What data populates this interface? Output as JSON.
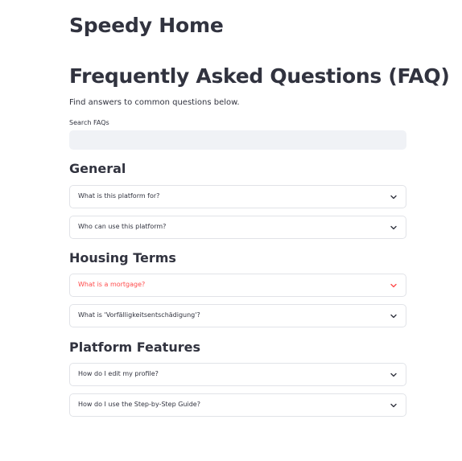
{
  "app": {
    "title": "Speedy Home"
  },
  "page": {
    "title": "Frequently Asked Questions (FAQ)",
    "subtitle": "Find answers to common questions below."
  },
  "search": {
    "label": "Search FAQs",
    "value": "",
    "placeholder": ""
  },
  "sections": [
    {
      "heading": "General",
      "items": [
        {
          "question": "What is this platform for?"
        },
        {
          "question": "Who can use this platform?"
        }
      ]
    },
    {
      "heading": "Housing Terms",
      "items": [
        {
          "question": "What is a mortgage?",
          "highlighted": true
        },
        {
          "question": "What is 'Vorfälligkeitsentschädigung'?"
        }
      ]
    },
    {
      "heading": "Platform Features",
      "items": [
        {
          "question": "How do I edit my profile?"
        },
        {
          "question": "How do I use the Step-by-Step Guide?"
        }
      ]
    }
  ],
  "icons": {
    "expander": "chevron-down-icon"
  },
  "colors": {
    "text": "#31333f",
    "accent": "#ff4b4b",
    "input_background": "#f0f2f6",
    "border": "#e1e3e8"
  }
}
